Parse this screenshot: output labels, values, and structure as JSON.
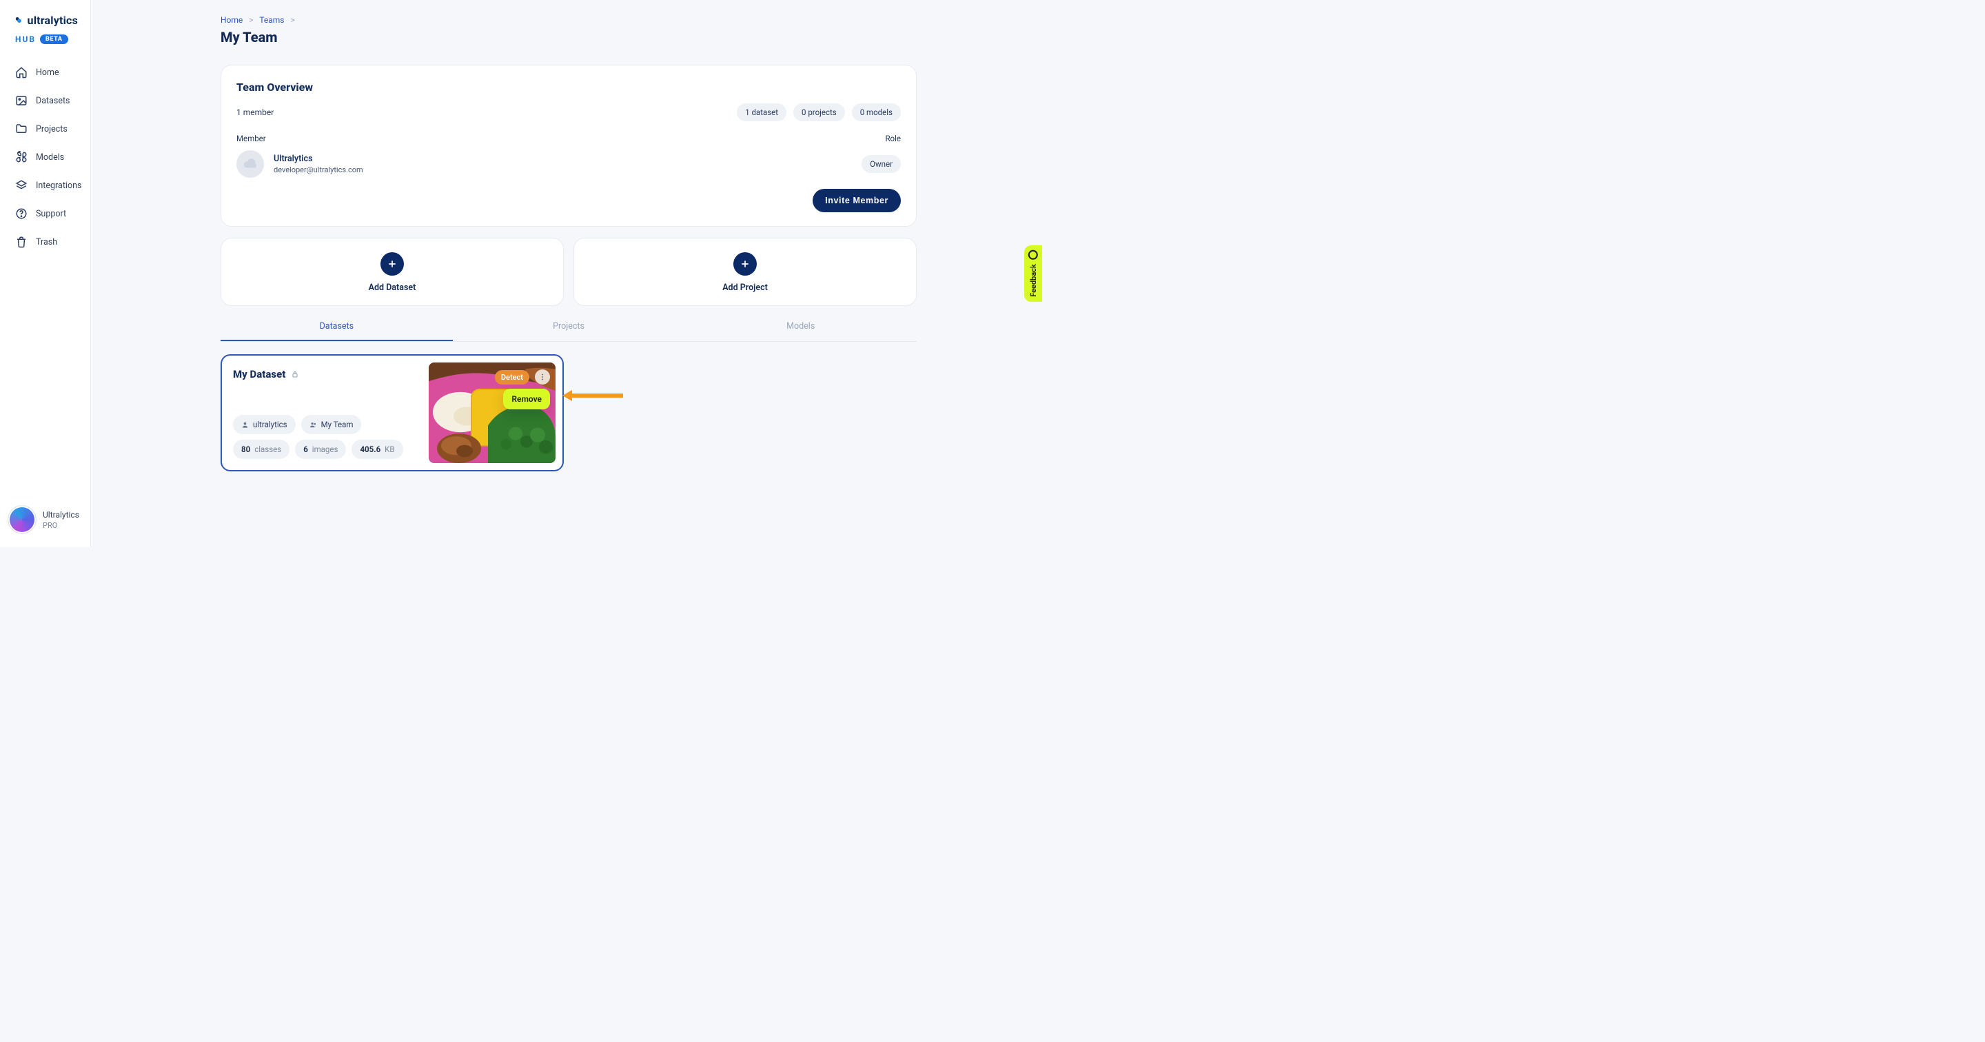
{
  "brand": {
    "name": "ultralytics",
    "hub": "HUB",
    "beta": "BETA"
  },
  "sidebar": {
    "items": [
      {
        "label": "Home"
      },
      {
        "label": "Datasets"
      },
      {
        "label": "Projects"
      },
      {
        "label": "Models"
      },
      {
        "label": "Integrations"
      },
      {
        "label": "Support"
      },
      {
        "label": "Trash"
      }
    ],
    "user": {
      "name": "Ultralytics",
      "tier": "PRO"
    }
  },
  "breadcrumb": {
    "home": "Home",
    "teams": "Teams"
  },
  "page_title": "My Team",
  "overview": {
    "heading": "Team Overview",
    "member_count": "1 member",
    "stats": {
      "datasets": "1 dataset",
      "projects": "0 projects",
      "models": "0 models"
    },
    "labels": {
      "member": "Member",
      "role": "Role"
    },
    "member": {
      "name": "Ultralytics",
      "email": "developer@ultralytics.com",
      "role": "Owner"
    },
    "invite_button": "Invite Member"
  },
  "add_cards": {
    "dataset": "Add Dataset",
    "project": "Add Project"
  },
  "tabs": {
    "datasets": "Datasets",
    "projects": "Projects",
    "models": "Models"
  },
  "dataset": {
    "title": "My Dataset",
    "owner": "ultralytics",
    "team": "My Team",
    "classes_n": "80",
    "classes_label": "classes",
    "images_n": "6",
    "images_label": "images",
    "size_n": "405.6",
    "size_unit": "KB",
    "detect_tag": "Detect",
    "menu_item": "Remove"
  },
  "feedback_label": "Feedback"
}
